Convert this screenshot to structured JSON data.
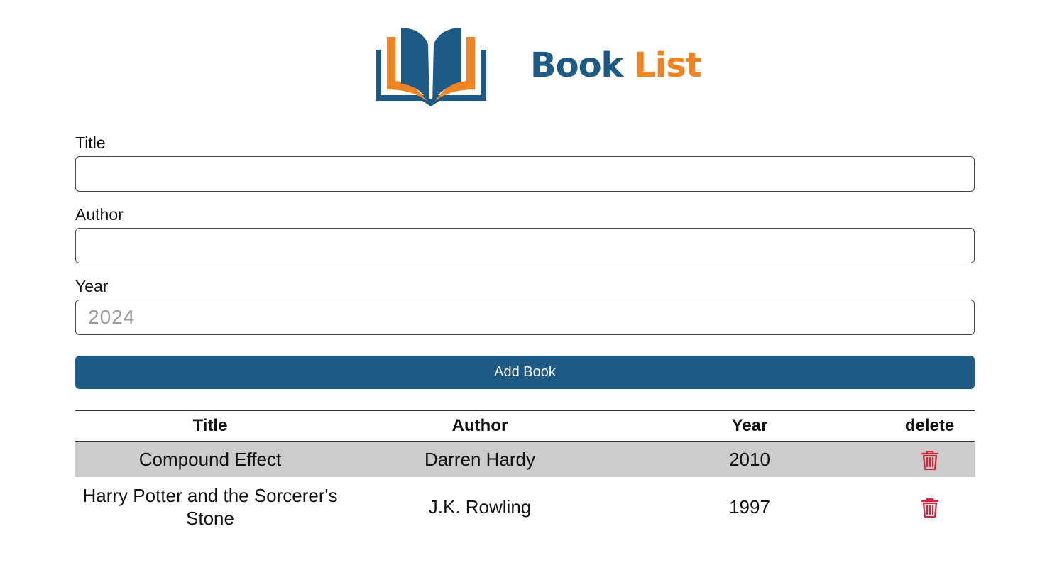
{
  "header": {
    "logo_icon": "open-book-icon",
    "title_part_1": "Book",
    "title_part_2": "List",
    "colors": {
      "primary": "#1d5a86",
      "accent": "#f08322"
    }
  },
  "form": {
    "title": {
      "label": "Title",
      "value": "",
      "placeholder": ""
    },
    "author": {
      "label": "Author",
      "value": "",
      "placeholder": ""
    },
    "year": {
      "label": "Year",
      "value": "",
      "placeholder": "2024"
    },
    "submit_label": "Add Book"
  },
  "table": {
    "headers": {
      "title": "Title",
      "author": "Author",
      "year": "Year",
      "delete": "delete"
    },
    "rows": [
      {
        "title": "Compound Effect",
        "author": "Darren Hardy",
        "year": "2010",
        "delete_icon": "trash-icon"
      },
      {
        "title": "Harry Potter and the Sorcerer's Stone",
        "author": "J.K. Rowling",
        "year": "1997",
        "delete_icon": "trash-icon"
      }
    ],
    "colors": {
      "shaded_row": "#cccccc",
      "delete_icon": "#d9253c"
    }
  }
}
